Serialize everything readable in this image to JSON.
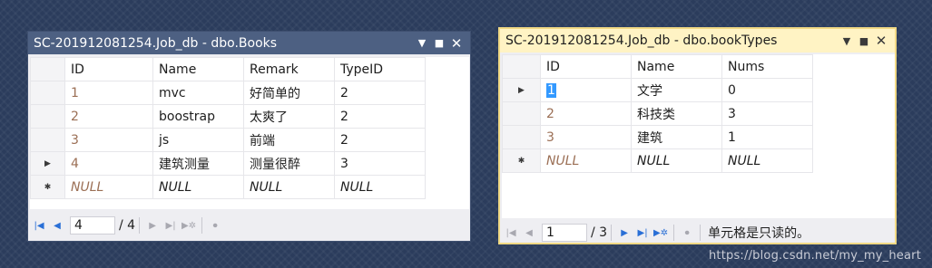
{
  "books": {
    "title": "SC-201912081254.Job_db - dbo.Books",
    "columns": [
      "ID",
      "Name",
      "Remark",
      "TypeID"
    ],
    "rows": [
      [
        "1",
        "mvc",
        "好简单的",
        "2"
      ],
      [
        "2",
        "boostrap",
        "太爽了",
        "2"
      ],
      [
        "3",
        "js",
        "前端",
        "2"
      ],
      [
        "4",
        "建筑测量",
        "测量很醉",
        "3"
      ],
      [
        "NULL",
        "NULL",
        "NULL",
        "NULL"
      ]
    ],
    "nav": {
      "position": "4",
      "total": "/ 4"
    }
  },
  "bookTypes": {
    "title": "SC-201912081254.Job_db - dbo.bookTypes",
    "columns": [
      "ID",
      "Name",
      "Nums"
    ],
    "rows": [
      [
        "1",
        "文学",
        "0"
      ],
      [
        "2",
        "科技类",
        "3"
      ],
      [
        "3",
        "建筑",
        "1"
      ],
      [
        "NULL",
        "NULL",
        "NULL"
      ]
    ],
    "nav": {
      "position": "1",
      "total": "/ 3",
      "status": "单元格是只读的。"
    }
  },
  "watermark": "https://blog.csdn.net/my_my_heart",
  "icons": {
    "pin": "chevron-down-icon",
    "maximize": "maximize-icon",
    "close": "close-icon",
    "current_row": "row-pointer-icon",
    "new_row": "new-row-icon",
    "nav_first": "first-record-icon",
    "nav_prev": "previous-record-icon",
    "nav_next": "next-record-icon",
    "nav_last": "last-record-icon",
    "nav_new": "new-record-icon",
    "nav_stop": "stop-icon"
  },
  "colors": {
    "active_title": "#4d6082",
    "inactive_title": "#fff3c4",
    "id_text": "#9b6f55",
    "selection": "#3399ff"
  }
}
